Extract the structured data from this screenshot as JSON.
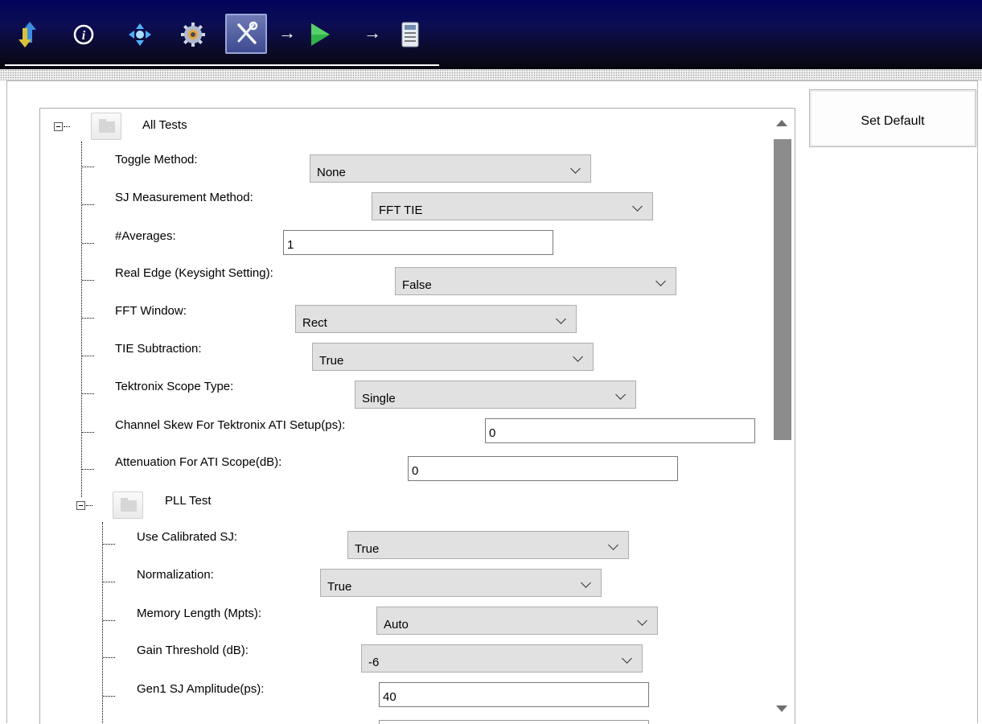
{
  "toolbar": {
    "icons": [
      "transfer-arrows-icon",
      "info-icon",
      "connection-icon",
      "gear-icon",
      "tools-icon",
      "run-icon",
      "report-icon"
    ],
    "selected": "tools-icon",
    "accent": "#0b0c55"
  },
  "set_default_label": "Set Default",
  "tree": {
    "all_tests": {
      "title": "All Tests",
      "settings": [
        {
          "label": "Toggle Method:",
          "type": "combo",
          "value": "None"
        },
        {
          "label": "SJ Measurement Method:",
          "type": "combo",
          "value": "FFT TIE"
        },
        {
          "label": "#Averages:",
          "type": "text",
          "value": "1"
        },
        {
          "label": "Real Edge (Keysight Setting):",
          "type": "combo",
          "value": "False"
        },
        {
          "label": "FFT Window:",
          "type": "combo",
          "value": "Rect"
        },
        {
          "label": "TIE Subtraction:",
          "type": "combo",
          "value": "True"
        },
        {
          "label": "Tektronix Scope Type:",
          "type": "combo",
          "value": "Single"
        },
        {
          "label": "Channel Skew For Tektronix ATI Setup(ps):",
          "type": "text",
          "value": "0"
        },
        {
          "label": "Attenuation For ATI Scope(dB):",
          "type": "text",
          "value": "0"
        }
      ]
    },
    "pll_test": {
      "title": "PLL Test",
      "settings": [
        {
          "label": "Use Calibrated SJ:",
          "type": "combo",
          "value": "True"
        },
        {
          "label": "Normalization:",
          "type": "combo",
          "value": "True"
        },
        {
          "label": "Memory Length (Mpts):",
          "type": "combo",
          "value": "Auto"
        },
        {
          "label": "Gain Threshold (dB):",
          "type": "combo",
          "value": "-6"
        },
        {
          "label": "Gen1 SJ Amplitude(ps):",
          "type": "text",
          "value": "40"
        }
      ]
    }
  }
}
